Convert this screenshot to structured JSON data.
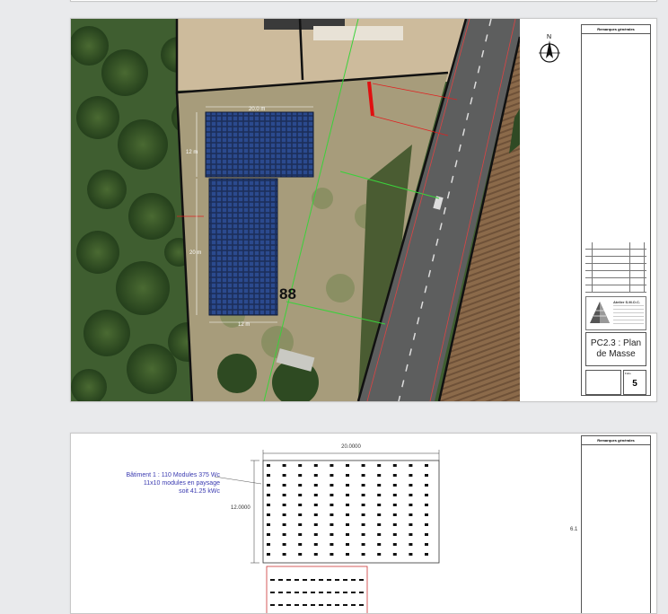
{
  "page1": {
    "north_label": "N",
    "plan_dims": {
      "top": "20.0 m",
      "left_top": "12 m",
      "left_bottom": "20 m",
      "bottom": "12 m"
    },
    "parcel_number": "88",
    "cartouche_header": "Remarques générales",
    "revision_rows": [
      "",
      "",
      "",
      "",
      ""
    ],
    "company": "Atelier S.M.O.C.",
    "title_line1": "PC2.3 : Plan",
    "title_line2": "de Masse",
    "sheet_label": "Folio",
    "sheet_number": "5"
  },
  "page2": {
    "cartouche_header": "Remarques générales",
    "dim_top": "20.0000",
    "dim_left": "12.0000",
    "dim_right": "6.1",
    "note_line1": "Bâtiment 1 : 110 Modules 375 Wc",
    "note_line2": "11x10 modules en paysage",
    "note_line3": "soit 41.25 kWc"
  }
}
